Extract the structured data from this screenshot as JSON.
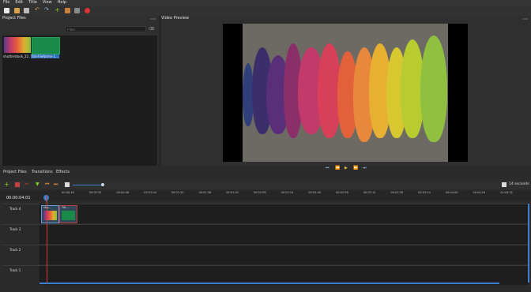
{
  "menu": [
    "File",
    "Edit",
    "Title",
    "View",
    "Help"
  ],
  "project_files": {
    "title": "Project Files",
    "filters": [
      "Show All",
      "Video",
      "Audio",
      "Image"
    ],
    "filter_placeholder": "Filter",
    "files": [
      {
        "name": "shutterstock_22...",
        "selected": false
      },
      {
        "name": "TitleFileName-1...",
        "selected": true
      }
    ]
  },
  "video_preview": {
    "title": "Video Preview"
  },
  "bottom_tabs": [
    "Project Files",
    "Transitions",
    "Effects"
  ],
  "timeline": {
    "timecode": "00:00:04:01",
    "zoom_label": "14 seconds",
    "ticks": [
      "00:00:16",
      "00:00:32",
      "00:00:48",
      "00:01:04",
      "00:01:20",
      "00:01:36",
      "00:01:52",
      "00:02:08",
      "00:02:24",
      "00:02:40",
      "00:02:56",
      "00:03:12",
      "00:03:28",
      "00:03:44",
      "00:04:00",
      "00:04:16",
      "00:04:32"
    ],
    "tracks": [
      {
        "name": "Track 4",
        "clips": [
          "sho...",
          "Titl..."
        ]
      },
      {
        "name": "Track 3",
        "clips": []
      },
      {
        "name": "Track 2",
        "clips": []
      },
      {
        "name": "Track 1",
        "clips": []
      }
    ]
  },
  "colors": {
    "accent": "#3b7fcf",
    "playhead": "#d23c3c"
  }
}
